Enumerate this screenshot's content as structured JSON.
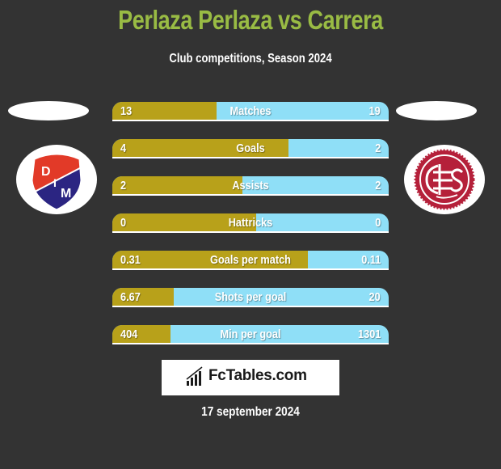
{
  "header": {
    "title": "Perlaza Perlaza vs Carrera",
    "subtitle": "Club competitions, Season 2024"
  },
  "teams": {
    "left": {
      "logo_icon": "dim-medellin-crest-icon",
      "logo_letters": [
        "D",
        "I",
        "M"
      ]
    },
    "right": {
      "logo_icon": "lanus-crest-icon"
    }
  },
  "colors": {
    "title": "#99bb44",
    "left_bar": "#b8a11a",
    "right_bar": "#8fdff7",
    "background": "#333333"
  },
  "stats": [
    {
      "label": "Matches",
      "left": "13",
      "right": "19",
      "left_share": 0.377
    },
    {
      "label": "Goals",
      "left": "4",
      "right": "2",
      "left_share": 0.637
    },
    {
      "label": "Assists",
      "left": "2",
      "right": "2",
      "left_share": 0.471
    },
    {
      "label": "Hattricks",
      "left": "0",
      "right": "0",
      "left_share": 0.52
    },
    {
      "label": "Goals per match",
      "left": "0.31",
      "right": "0.11",
      "left_share": 0.708
    },
    {
      "label": "Shots per goal",
      "left": "6.67",
      "right": "20",
      "left_share": 0.222
    },
    {
      "label": "Min per goal",
      "left": "404",
      "right": "1301",
      "left_share": 0.211
    }
  ],
  "brand": {
    "name": "FcTables.com",
    "icon": "bar-chart-icon"
  },
  "date": "17 september 2024"
}
